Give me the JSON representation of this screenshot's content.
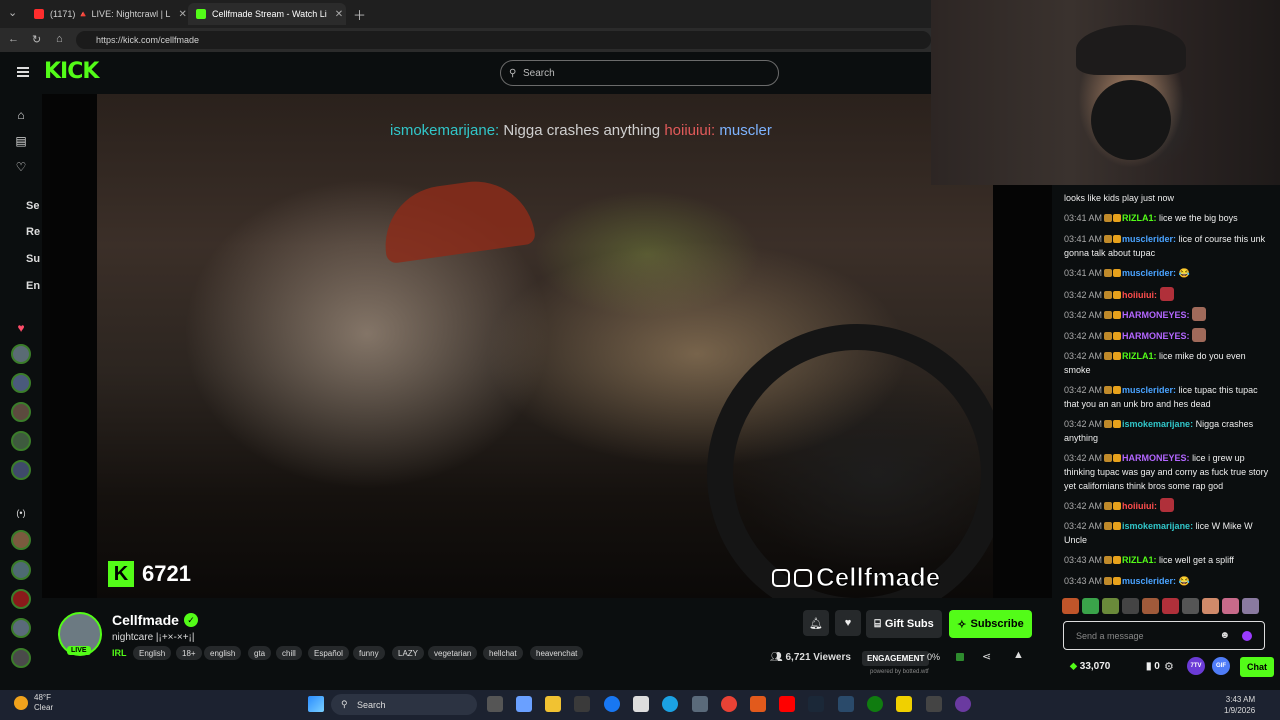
{
  "browser": {
    "tabs": [
      {
        "label": "(1171) 🔺 LIVE: Nightcrawl | L"
      },
      {
        "label": "Cellfmade Stream - Watch Li"
      }
    ],
    "url": "https://kick.com/cellfmade"
  },
  "header": {
    "logo": "KICK",
    "search_placeholder": "Search"
  },
  "sidebar": {
    "labels": [
      "Se",
      "Re",
      "Su",
      "En"
    ]
  },
  "overlay": {
    "chat_user": "ismokemarijane:",
    "chat_text": "Nigga crashes anything",
    "chat_user2": "hoiiuiui:",
    "chat_user3": "muscler",
    "viewer_count": "6721",
    "brand": "Cellfmade"
  },
  "streamer": {
    "name": "Cellfmade",
    "title": "nightcare |¡+×-×+¡|",
    "live": "LIVE",
    "category": "IRL",
    "tags": [
      "English",
      "18+",
      "english",
      "gta",
      "chill",
      "Español",
      "funny",
      "LAZY",
      "vegetarian",
      "hellchat",
      "heavenchat"
    ],
    "gift_label": "Gift Subs",
    "subscribe_label": "Subscribe",
    "viewers": "6,721 Viewers",
    "engagement_label": "ENGAGEMENT",
    "engagement_value": "0%",
    "powered_by": "powered by botted.wtf"
  },
  "chat": {
    "messages": [
      {
        "time": "",
        "user": "",
        "text": "looks like kids play just now",
        "color": "#ffffff"
      },
      {
        "time": "03:41 AM",
        "user": "RIZLA1:",
        "text": "lice we the big boys",
        "color": "#53fc18"
      },
      {
        "time": "03:41 AM",
        "user": "musclerider:",
        "text": "lice of course this unk gonna talk about tupac",
        "color": "#4aa3ff"
      },
      {
        "time": "03:41 AM",
        "user": "musclerider:",
        "text": "😂",
        "color": "#4aa3ff"
      },
      {
        "time": "03:42 AM",
        "user": "hoiiuiui:",
        "text": "",
        "color": "#ff4d4d"
      },
      {
        "time": "03:42 AM",
        "user": "HARMONEYES:",
        "text": "",
        "color": "#b366ff"
      },
      {
        "time": "03:42 AM",
        "user": "HARMONEYES:",
        "text": "",
        "color": "#b366ff"
      },
      {
        "time": "03:42 AM",
        "user": "RIZLA1:",
        "text": "lice mike do you even smoke",
        "color": "#53fc18"
      },
      {
        "time": "03:42 AM",
        "user": "musclerider:",
        "text": "lice tupac this tupac that you an an unk bro and hes dead",
        "color": "#4aa3ff"
      },
      {
        "time": "03:42 AM",
        "user": "ismokemarijane:",
        "text": "Nigga crashes anything",
        "color": "#31c6c9"
      },
      {
        "time": "03:42 AM",
        "user": "HARMONEYES:",
        "text": "lice i grew up thinking tupac was gay and corny as fuck true story yet californians think bros some rap god",
        "color": "#b366ff"
      },
      {
        "time": "03:42 AM",
        "user": "hoiiuiui:",
        "text": "",
        "color": "#ff4d4d"
      },
      {
        "time": "03:42 AM",
        "user": "ismokemarijane:",
        "text": "lice W Mike W Uncle",
        "color": "#31c6c9"
      },
      {
        "time": "03:43 AM",
        "user": "RIZLA1:",
        "text": "lice well get a spliff",
        "color": "#53fc18"
      },
      {
        "time": "03:43 AM",
        "user": "musclerider:",
        "text": "😂",
        "color": "#4aa3ff"
      }
    ],
    "input_placeholder": "Send a message",
    "points": "33,070",
    "zero": "0",
    "chat_button": "Chat",
    "circle_labels": [
      "7TV",
      "GIF",
      "GIF"
    ]
  },
  "taskbar": {
    "temp": "48°F",
    "condition": "Clear",
    "search": "Search",
    "time": "3:43 AM",
    "date": "1/9/2026"
  },
  "colors": {
    "kick_green": "#53fc18",
    "bg": "#0b0e0f"
  }
}
